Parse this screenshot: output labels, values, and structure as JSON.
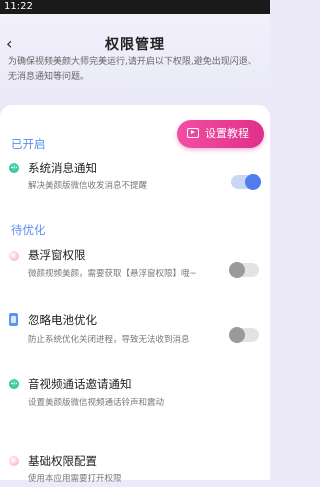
{
  "status_bar": {
    "time": "11:22"
  },
  "header": {
    "back_icon": "back-arrow-icon",
    "title": "权限管理"
  },
  "notice": "为确保视频美颜大师完美运行,请开启以下权限,避免出现闪退、无消息通知等问题。",
  "tutorial_button": {
    "label": "设置教程",
    "icon": "video-play-icon"
  },
  "sections": {
    "enabled": "已开启",
    "to_optimize": "待优化"
  },
  "items": [
    {
      "title": "系统消息通知",
      "desc": "解决美颜版微信收发消息不提醒",
      "icon": "chat-dots-icon",
      "toggle": true
    },
    {
      "title": "悬浮窗权限",
      "desc": "微颜视频美颜，需要获取【悬浮窗权限】哦~",
      "icon": "pink-dot-icon",
      "toggle": false
    },
    {
      "title": "忽略电池优化",
      "desc": "防止系统优化关闭进程，导致无法收到消息",
      "icon": "battery-icon",
      "toggle": false
    },
    {
      "title": "音视频通话邀请通知",
      "desc": "设置美颜版微信视频通话铃声和震动",
      "icon": "chat-dots-icon",
      "toggle": null
    },
    {
      "title": "基础权限配置",
      "desc": "使用本应用需要打开权限",
      "icon": "pink-dot-icon",
      "toggle": null
    }
  ],
  "colors": {
    "accent_blue": "#4f7df0",
    "section_blue": "#5b8ef0",
    "pink_button": "#e02f8a"
  }
}
